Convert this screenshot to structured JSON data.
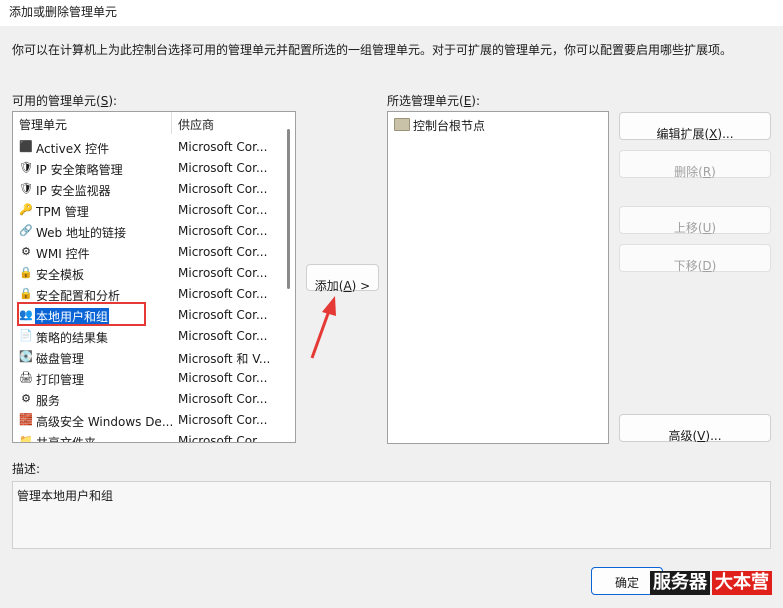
{
  "window": {
    "title": "添加或删除管理单元"
  },
  "intro_text": "你可以在计算机上为此控制台选择可用的管理单元并配置所选的一组管理单元。对于可扩展的管理单元，你可以配置要启用哪些扩展项。",
  "available": {
    "label_prefix": "可用的管理单元(",
    "label_key": "S",
    "label_suffix": "):",
    "col_name": "管理单元",
    "col_vendor": "供应商",
    "items": [
      {
        "name": "ActiveX 控件",
        "vendor": "Microsoft Cor...",
        "icon": "activex-icon"
      },
      {
        "name": "IP 安全策略管理",
        "vendor": "Microsoft Cor...",
        "icon": "ip-policy-icon"
      },
      {
        "name": "IP 安全监视器",
        "vendor": "Microsoft Cor...",
        "icon": "ip-monitor-icon"
      },
      {
        "name": "TPM 管理",
        "vendor": "Microsoft Cor...",
        "icon": "tpm-icon"
      },
      {
        "name": "Web 地址的链接",
        "vendor": "Microsoft Cor...",
        "icon": "web-link-icon"
      },
      {
        "name": "WMI 控件",
        "vendor": "Microsoft Cor...",
        "icon": "wmi-icon"
      },
      {
        "name": "安全模板",
        "vendor": "Microsoft Cor...",
        "icon": "security-template-icon"
      },
      {
        "name": "安全配置和分析",
        "vendor": "Microsoft Cor...",
        "icon": "security-analysis-icon"
      },
      {
        "name": "本地用户和组",
        "vendor": "Microsoft Cor...",
        "icon": "users-groups-icon"
      },
      {
        "name": "策略的结果集",
        "vendor": "Microsoft Cor...",
        "icon": "rsop-icon"
      },
      {
        "name": "磁盘管理",
        "vendor": "Microsoft 和 V...",
        "icon": "disk-icon"
      },
      {
        "name": "打印管理",
        "vendor": "Microsoft Cor...",
        "icon": "printer-icon"
      },
      {
        "name": "服务",
        "vendor": "Microsoft Cor...",
        "icon": "services-icon"
      },
      {
        "name": "高级安全 Windows De...",
        "vendor": "Microsoft Cor...",
        "icon": "firewall-icon"
      },
      {
        "name": "共享文件夹",
        "vendor": "Microsoft Cor...",
        "icon": "shared-folder-icon"
      }
    ]
  },
  "add_button": {
    "prefix": "添加(",
    "key": "A",
    "suffix": ") >"
  },
  "selected": {
    "label_prefix": "所选管理单元(",
    "label_key": "E",
    "label_suffix": "):",
    "root": "控制台根节点"
  },
  "buttons": {
    "edit_ext": {
      "prefix": "编辑扩展(",
      "key": "X",
      "suffix": ")..."
    },
    "remove": {
      "prefix": "删除(",
      "key": "R",
      "suffix": ")"
    },
    "move_up": {
      "prefix": "上移(",
      "key": "U",
      "suffix": ")"
    },
    "move_down": {
      "prefix": "下移(",
      "key": "D",
      "suffix": ")"
    },
    "advanced": {
      "prefix": "高级(",
      "key": "V",
      "suffix": ")..."
    },
    "ok": "确定"
  },
  "description": {
    "label": "描述:",
    "text": "管理本地用户和组"
  },
  "watermark": {
    "part1": "服务器",
    "part2": "大本营"
  },
  "colors": {
    "selection": "#0a64d6",
    "highlight_box": "#e53935",
    "arrow": "#e53935"
  }
}
